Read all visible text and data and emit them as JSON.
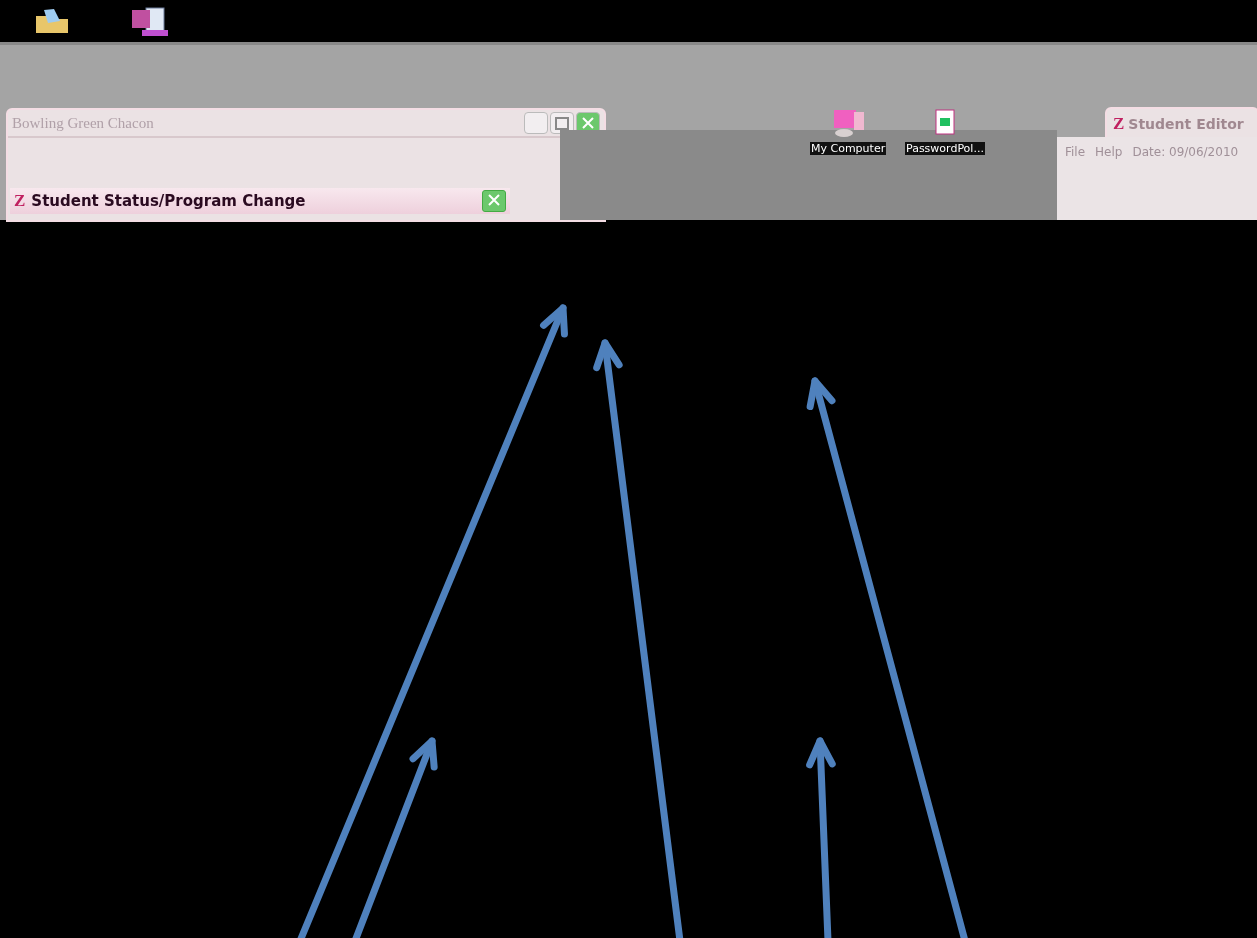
{
  "left_window": {
    "title": "Bowling Green Chacon",
    "dialog": {
      "logo": "Z",
      "title": "Student Status/Program Change"
    }
  },
  "desktop_icons": [
    {
      "label": "My Computer",
      "kind": "computer"
    },
    {
      "label": "PasswordPol...",
      "kind": "document"
    }
  ],
  "right_window": {
    "logo": "Z",
    "title": "Student Editor",
    "menu": [
      "File",
      "Help"
    ],
    "date": "Date: 09/06/2010"
  }
}
